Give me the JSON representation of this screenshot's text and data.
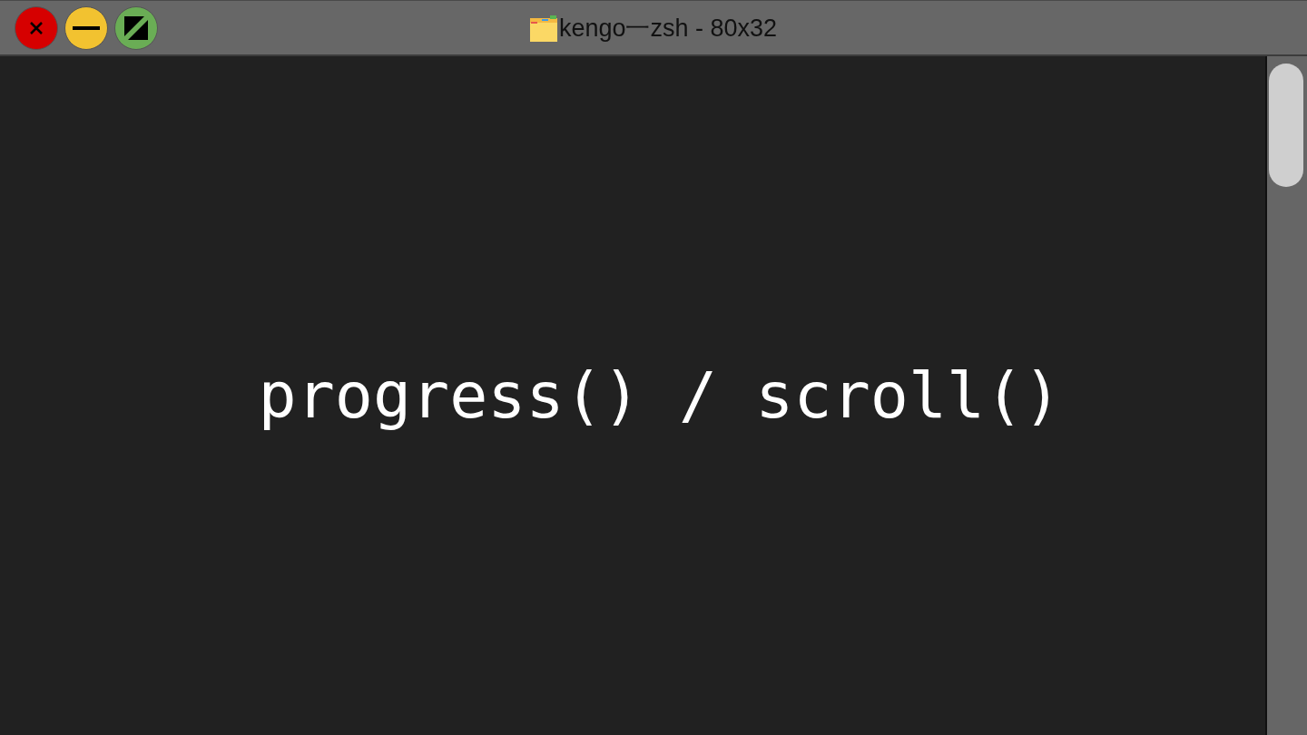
{
  "window": {
    "title": "kengo一zsh - 80x32"
  },
  "terminal": {
    "text": "progress() / scroll()"
  }
}
